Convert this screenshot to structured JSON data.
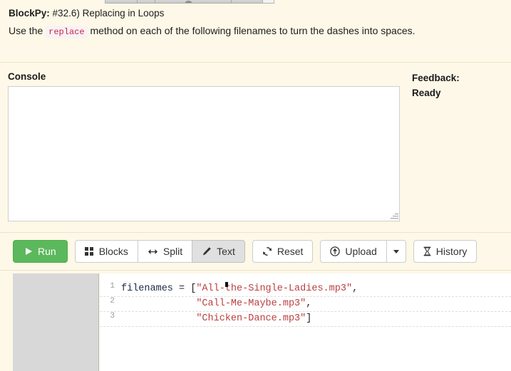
{
  "app": {
    "brand": "BlockPy:",
    "assignment_title": "#32.6) Replacing in Loops",
    "instruction_prefix": "Use the",
    "instruction_code": "replace",
    "instruction_suffix": "method on each of the following filenames to turn the dashes into spaces.",
    "background_color": "#fdf8e7",
    "accent_color": "#5cb85c",
    "code_token_color": "#c7254e"
  },
  "console": {
    "label": "Console",
    "value": "",
    "placeholder": ""
  },
  "feedback": {
    "label": "Feedback:",
    "status": "Ready"
  },
  "toolbar": {
    "run_label": "Run",
    "blocks_label": "Blocks",
    "split_label": "Split",
    "text_label": "Text",
    "reset_label": "Reset",
    "upload_label": "Upload",
    "upload_caret_label": "",
    "history_label": "History",
    "active_view": "Text"
  },
  "editor": {
    "line_numbers": [
      "1",
      "2",
      "3"
    ],
    "lines": [
      {
        "number": "1",
        "tokens": [
          {
            "text": "filenames ",
            "type": "name"
          },
          {
            "text": "= [",
            "type": "op"
          },
          {
            "text": "\"All-the-Single-Ladies.mp3\"",
            "type": "str"
          },
          {
            "text": ",",
            "type": "op"
          }
        ]
      },
      {
        "number": "2",
        "tokens": [
          {
            "text": "             ",
            "type": "op"
          },
          {
            "text": "\"Call-Me-Maybe.mp3\"",
            "type": "str"
          },
          {
            "text": ",",
            "type": "op"
          }
        ]
      },
      {
        "number": "3",
        "tokens": [
          {
            "text": "             ",
            "type": "op"
          },
          {
            "text": "\"Chicken-Dance.mp3\"",
            "type": "str"
          },
          {
            "text": "]",
            "type": "op"
          }
        ]
      }
    ]
  }
}
